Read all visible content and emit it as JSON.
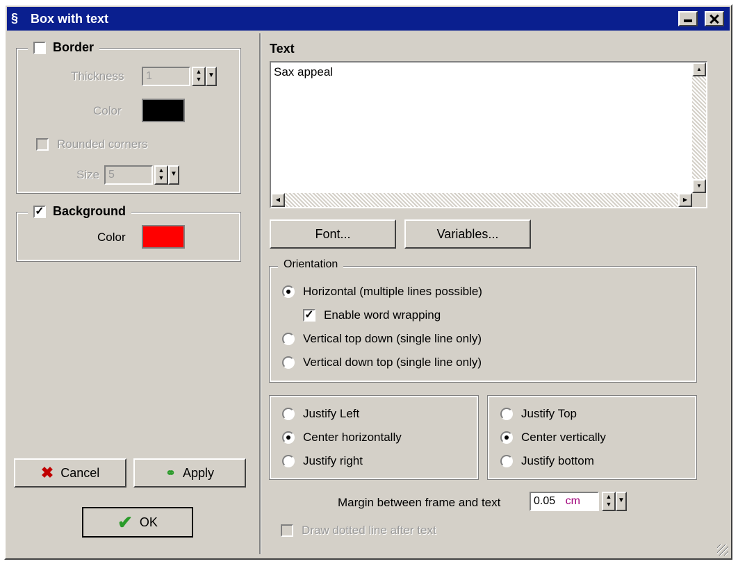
{
  "window": {
    "title": "Box with text"
  },
  "border": {
    "label": "Border",
    "checked": false,
    "thickness_label": "Thickness",
    "thickness_value": "1",
    "color_label": "Color",
    "color": "#000000",
    "rounded_label": "Rounded corners",
    "size_label": "Size",
    "size_value": "5"
  },
  "background": {
    "label": "Background",
    "checked": true,
    "color_label": "Color",
    "color": "#ff0000"
  },
  "buttons": {
    "cancel": "Cancel",
    "apply": "Apply",
    "ok": "OK",
    "font": "Font...",
    "variables": "Variables..."
  },
  "text": {
    "label": "Text",
    "value": "Sax appeal"
  },
  "orientation": {
    "label": "Orientation",
    "horizontal": "Horizontal (multiple lines possible)",
    "word_wrap": "Enable word wrapping",
    "vertical_top_down": "Vertical top down (single line only)",
    "vertical_down_top": "Vertical down top (single line only)"
  },
  "justify_h": {
    "left": "Justify Left",
    "center": "Center horizontally",
    "right": "Justify right"
  },
  "justify_v": {
    "top": "Justify Top",
    "center": "Center vertically",
    "bottom": "Justify bottom"
  },
  "margin": {
    "label": "Margin between frame and text",
    "value": "0.05",
    "unit": "cm"
  },
  "dotted_line": {
    "label": "Draw dotted line after text"
  }
}
